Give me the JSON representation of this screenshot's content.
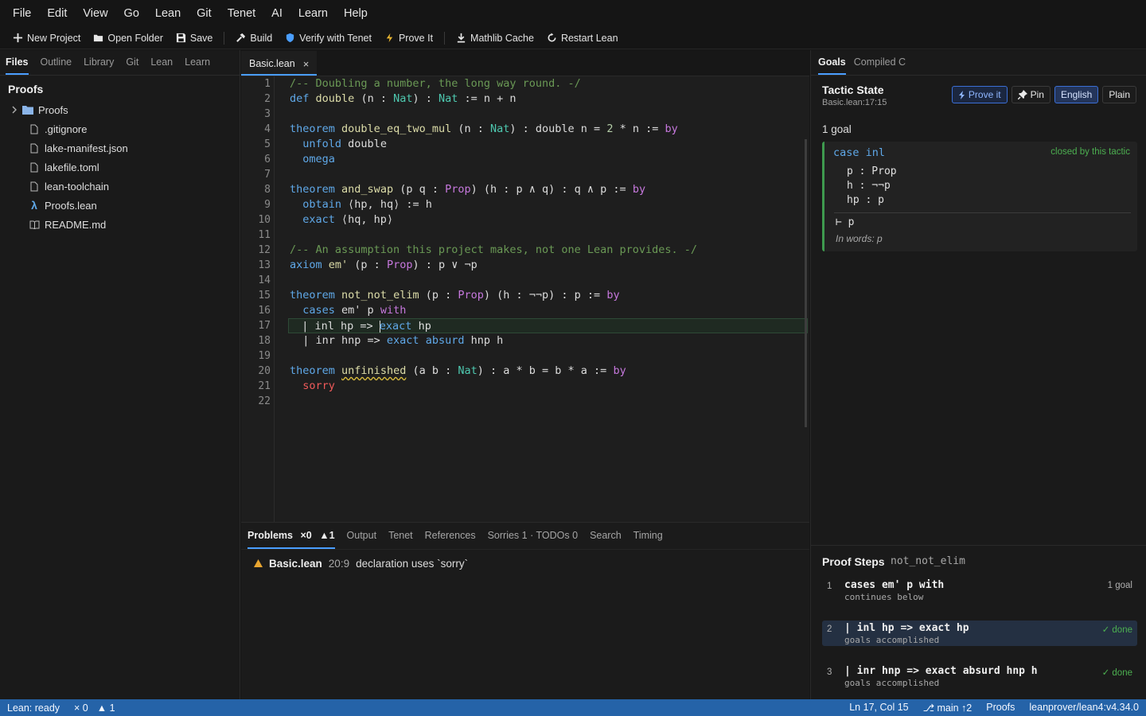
{
  "menu": [
    "File",
    "Edit",
    "View",
    "Go",
    "Lean",
    "Git",
    "Tenet",
    "AI",
    "Learn",
    "Help"
  ],
  "toolbar": {
    "new_project": "New Project",
    "open_folder": "Open Folder",
    "save": "Save",
    "build": "Build",
    "verify": "Verify with Tenet",
    "prove": "Prove It",
    "mathlib": "Mathlib Cache",
    "restart": "Restart Lean"
  },
  "sidebar": {
    "tabs": [
      "Files",
      "Outline",
      "Library",
      "Git",
      "Lean",
      "Learn"
    ],
    "title": "Proofs",
    "folder": "Proofs",
    "files": [
      ".gitignore",
      "lake-manifest.json",
      "lakefile.toml",
      "lean-toolchain",
      "Proofs.lean",
      "README.md"
    ]
  },
  "editor": {
    "tab": "Basic.lean",
    "close": "×",
    "line_numbers": [
      "1",
      "2",
      "3",
      "4",
      "5",
      "6",
      "7",
      "8",
      "9",
      "10",
      "11",
      "12",
      "13",
      "14",
      "15",
      "16",
      "17",
      "18",
      "19",
      "20",
      "21",
      "22"
    ]
  },
  "panel": {
    "tabs": {
      "problems": "Problems",
      "err": "×0",
      "warn": "▲1",
      "output": "Output",
      "tenet": "Tenet",
      "references": "References",
      "sorries": "Sorries 1 · TODOs 0",
      "search": "Search",
      "timing": "Timing"
    },
    "problem": {
      "file": "Basic.lean",
      "loc": "20:9",
      "msg": "declaration uses `sorry`"
    }
  },
  "goals": {
    "tabs": [
      "Goals",
      "Compiled C"
    ],
    "title": "Tactic State",
    "location": "Basic.lean:17:15",
    "btn_prove": "Prove it",
    "btn_pin": "Pin",
    "btn_english": "English",
    "btn_plain": "Plain",
    "count": "1 goal",
    "case_kw": "case",
    "case_name": "inl",
    "closed": "closed by this tactic",
    "hyps": [
      "p : Prop",
      "h : ¬¬p",
      "hp : p"
    ],
    "target": "⊢ p",
    "words": "In words: p"
  },
  "steps": {
    "title": "Proof Steps",
    "theorem": "not_not_elim",
    "items": [
      {
        "n": "1",
        "code": "cases em' p with",
        "sub": "continues below",
        "status": "1 goal"
      },
      {
        "n": "2",
        "code": "| inl hp => exact hp",
        "sub": "goals accomplished",
        "status": "✓ done"
      },
      {
        "n": "3",
        "code": "| inr hnp => exact absurd hnp h",
        "sub": "goals accomplished",
        "status": "✓ done"
      }
    ]
  },
  "status": {
    "lean": "Lean: ready",
    "err": "× 0",
    "warn": "▲ 1",
    "pos": "Ln 17, Col 15",
    "branch": "⎇ main ↑2",
    "project": "Proofs",
    "toolchain": "leanprover/lean4:v4.34.0"
  },
  "colors": {
    "accent": "#4a9eff",
    "statusbar": "#2563a8",
    "success": "#4caf50",
    "warning": "#e8a530"
  }
}
